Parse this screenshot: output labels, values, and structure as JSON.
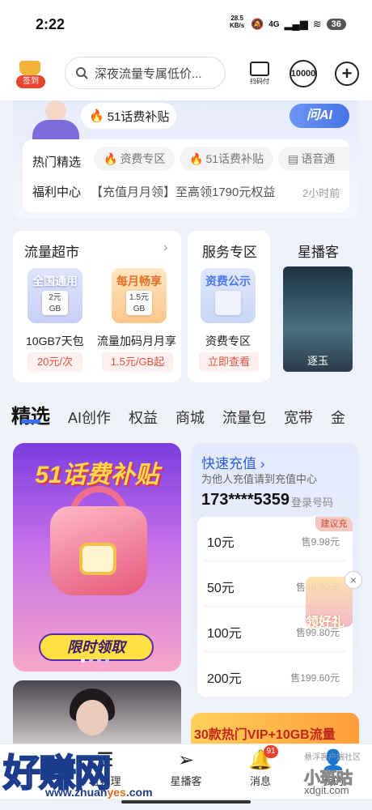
{
  "status": {
    "time": "2:22",
    "speed_value": "28.5",
    "speed_unit": "KB/s",
    "network": "4G",
    "battery": "36"
  },
  "header": {
    "checkin_label": "签到",
    "search_placeholder": "深夜流量专属低价...",
    "scan_label": "扫码付",
    "service_label": "10000"
  },
  "top": {
    "subsidy_chip": "51话费补贴",
    "ask_ai": "问AI",
    "hot_label": "热门精选",
    "hot_chips": [
      "资费专区",
      "51话费补贴",
      "语音通"
    ],
    "welfare_label": "福利中心",
    "welfare_text": "【充值月月领】至高领1790元权益",
    "welfare_time": "2小时前"
  },
  "cards": {
    "traffic": {
      "title": "流量超市",
      "items": [
        {
          "tile_title": "全国通用",
          "tile_chip": "2元 GB",
          "name": "10GB7天包",
          "price": "20元/次"
        },
        {
          "tile_title": "每月畅享",
          "tile_chip": "1.5元 GB",
          "name": "流量加码月月享",
          "price": "1.5元/GB起"
        }
      ]
    },
    "service": {
      "title": "服务专区",
      "tile_title": "资费公示",
      "name": "资费专区",
      "button": "立即查看"
    },
    "stars": {
      "title": "星播客",
      "poster_text": "逐玉"
    }
  },
  "tabs": [
    "精选",
    "AI创作",
    "权益",
    "商城",
    "流量包",
    "宽带",
    "金"
  ],
  "promo": {
    "title": "51话费补贴",
    "button": "限时领取"
  },
  "recharge": {
    "title": "快速充值",
    "subtitle": "为他人充值请到充值中心",
    "number": "173****5359",
    "login": "登录号码",
    "badge": "建议充",
    "options": [
      {
        "amount": "10元",
        "price": "售9.98元"
      },
      {
        "amount": "50元",
        "price": "售49.90元"
      },
      {
        "amount": "100元",
        "price": "售99.80元"
      },
      {
        "amount": "200元",
        "price": "售199.60元"
      }
    ],
    "gift_text": "领好礼"
  },
  "vip_banner": "30款热门VIP+10GB流量",
  "nav": {
    "items": [
      "订办理",
      "星播客",
      "消息",
      "我的"
    ],
    "message_badge": "91"
  },
  "watermark": {
    "main": "好赚网",
    "url_a": "www.zhuan",
    "url_b": "yes",
    "url_c": ".com",
    "right_top": "悬浮客户端社区",
    "right_main": "小斑咕",
    "right_url": "xdgit.com"
  },
  "colors": {
    "accent": "#3b6ef5",
    "price_red": "#e3533e",
    "promo_yellow": "#ffd94a"
  }
}
